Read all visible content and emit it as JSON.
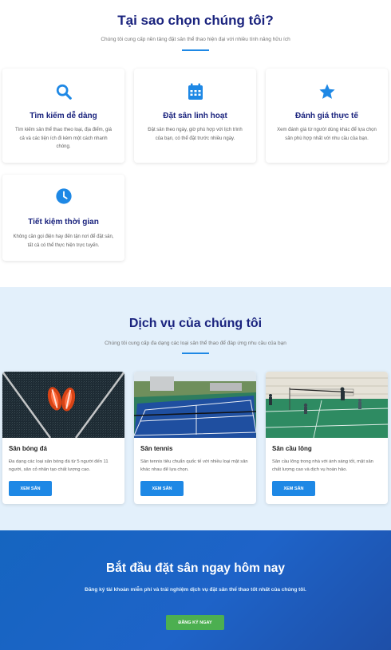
{
  "why": {
    "title": "Tại sao chọn chúng tôi?",
    "subtitle": "Chúng tôi cung cấp nền tảng đặt sân thể thao hiện đại với nhiều tính năng hữu ích",
    "features": [
      {
        "icon": "search-icon",
        "title": "Tìm kiếm dễ dàng",
        "desc": "Tìm kiếm sân thể thao theo loại, địa điểm, giá cả và các tiện ích đi kèm một cách nhanh chóng."
      },
      {
        "icon": "calendar-icon",
        "title": "Đặt sân linh hoạt",
        "desc": "Đặt sân theo ngày, giờ phù hợp với lịch trình của bạn, có thể đặt trước nhiều ngày."
      },
      {
        "icon": "star-icon",
        "title": "Đánh giá thực tế",
        "desc": "Xem đánh giá từ người dùng khác để lựa chọn sân phù hợp nhất với nhu cầu của bạn."
      },
      {
        "icon": "clock-icon",
        "title": "Tiết kiệm thời gian",
        "desc": "Không cần gọi điện hay đến tận nơi để đặt sân, tất cả có thể thực hiện trực tuyến."
      }
    ]
  },
  "services": {
    "title": "Dịch vụ của chúng tôi",
    "subtitle": "Chúng tôi cung cấp đa dạng các loại sân thể thao để đáp ứng nhu cầu của bạn",
    "items": [
      {
        "title": "Sân bóng đá",
        "desc": "Đa dạng các loại sân bóng đá từ 5 người đến 11 người, sân cỏ nhân tạo chất lượng cao.",
        "button": "XEM SÂN"
      },
      {
        "title": "Sân tennis",
        "desc": "Sân tennis tiêu chuẩn quốc tế với nhiều loại mặt sân khác nhau để lựa chọn.",
        "button": "XEM SÂN"
      },
      {
        "title": "Sân cầu lông",
        "desc": "Sân cầu lông trong nhà với ánh sáng tốt, mặt sân chất lượng cao và dịch vụ hoàn hảo.",
        "button": "XEM SÂN"
      }
    ]
  },
  "cta": {
    "title": "Bắt đầu đặt sân ngay hôm nay",
    "desc": "Đăng ký tài khoản miễn phí và trải nghiệm dịch vụ đặt sân thể thao tốt nhất của chúng tôi.",
    "button": "ĐĂNG KÝ NGAY"
  },
  "colors": {
    "primary": "#1e88e5",
    "heading": "#1a237e",
    "cta_button": "#4caf50",
    "services_bg": "#e3f0fb"
  }
}
